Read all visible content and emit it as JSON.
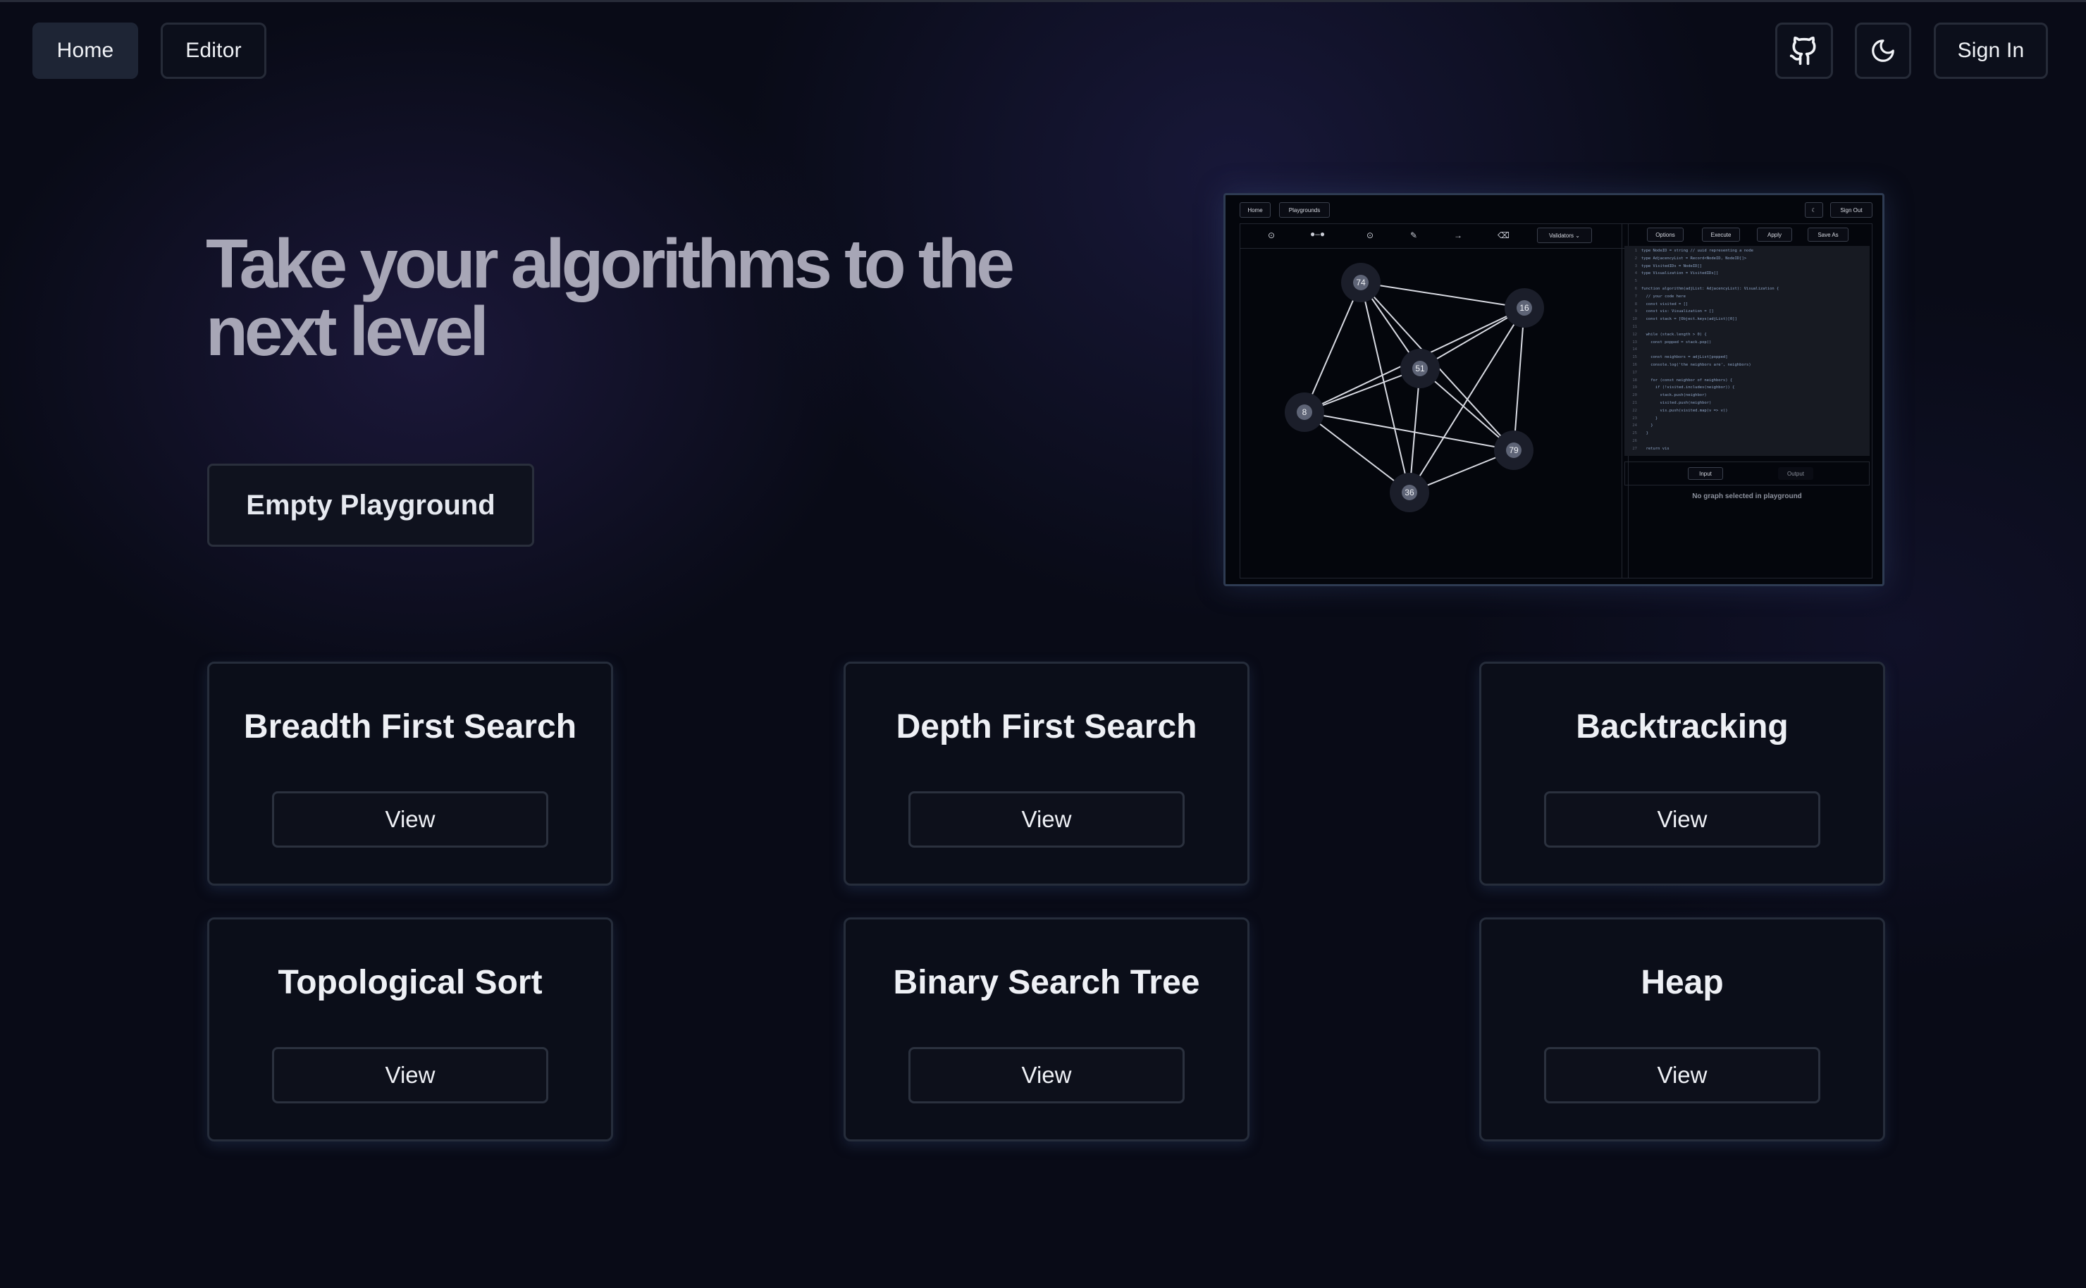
{
  "nav": {
    "home_label": "Home",
    "editor_label": "Editor",
    "github_icon": "github-icon",
    "theme_icon": "moon-icon",
    "signin_label": "Sign In"
  },
  "hero": {
    "title_line1": "Take your algorithms to the",
    "title_line2": "next level",
    "cta_label": "Empty Playground"
  },
  "preview": {
    "nav_home": "Home",
    "nav_playgrounds": "Playgrounds",
    "nav_signout": "Sign Out",
    "validators_label": "Validators",
    "tabs": [
      "Options",
      "Execute",
      "Apply",
      "Save As"
    ],
    "io_tabs": [
      "Input",
      "Output"
    ],
    "empty_message": "No graph selected in playground",
    "nodes": [
      "74",
      "16",
      "51",
      "8",
      "79",
      "36"
    ],
    "code_lines": [
      "type NodeID = string // uuid representing a node",
      "type AdjacencyList = Record<NodeID, NodeID[]>",
      "type VisitedIDs = NodeID[]",
      "type Visualization = VisitedIDs[]",
      "",
      "function algorithm(adjList: AdjacencyList): Visualization {",
      "  // your code here",
      "  const visited = []",
      "  const vis: Visualization = []",
      "  const stack = [Object.keys(adjList)[0]]",
      "",
      "  while (stack.length > 0) {",
      "    const popped = stack.pop()",
      "",
      "    const neighbors = adjList[popped]",
      "    console.log('the neighbors are', neighbors)",
      "",
      "    for (const neighbor of neighbors) {",
      "      if (!visited.includes(neighbor)) {",
      "        stack.push(neighbor)",
      "        visited.push(neighbor)",
      "        vis.push(visited.map(v => v))",
      "      }",
      "    }",
      "  }",
      "",
      "  return vis"
    ]
  },
  "cards": [
    {
      "title": "Breadth First Search",
      "button": "View"
    },
    {
      "title": "Depth First Search",
      "button": "View"
    },
    {
      "title": "Backtracking",
      "button": "View"
    },
    {
      "title": "Topological Sort",
      "button": "View"
    },
    {
      "title": "Binary Search Tree",
      "button": "View"
    },
    {
      "title": "Heap",
      "button": "View"
    }
  ]
}
